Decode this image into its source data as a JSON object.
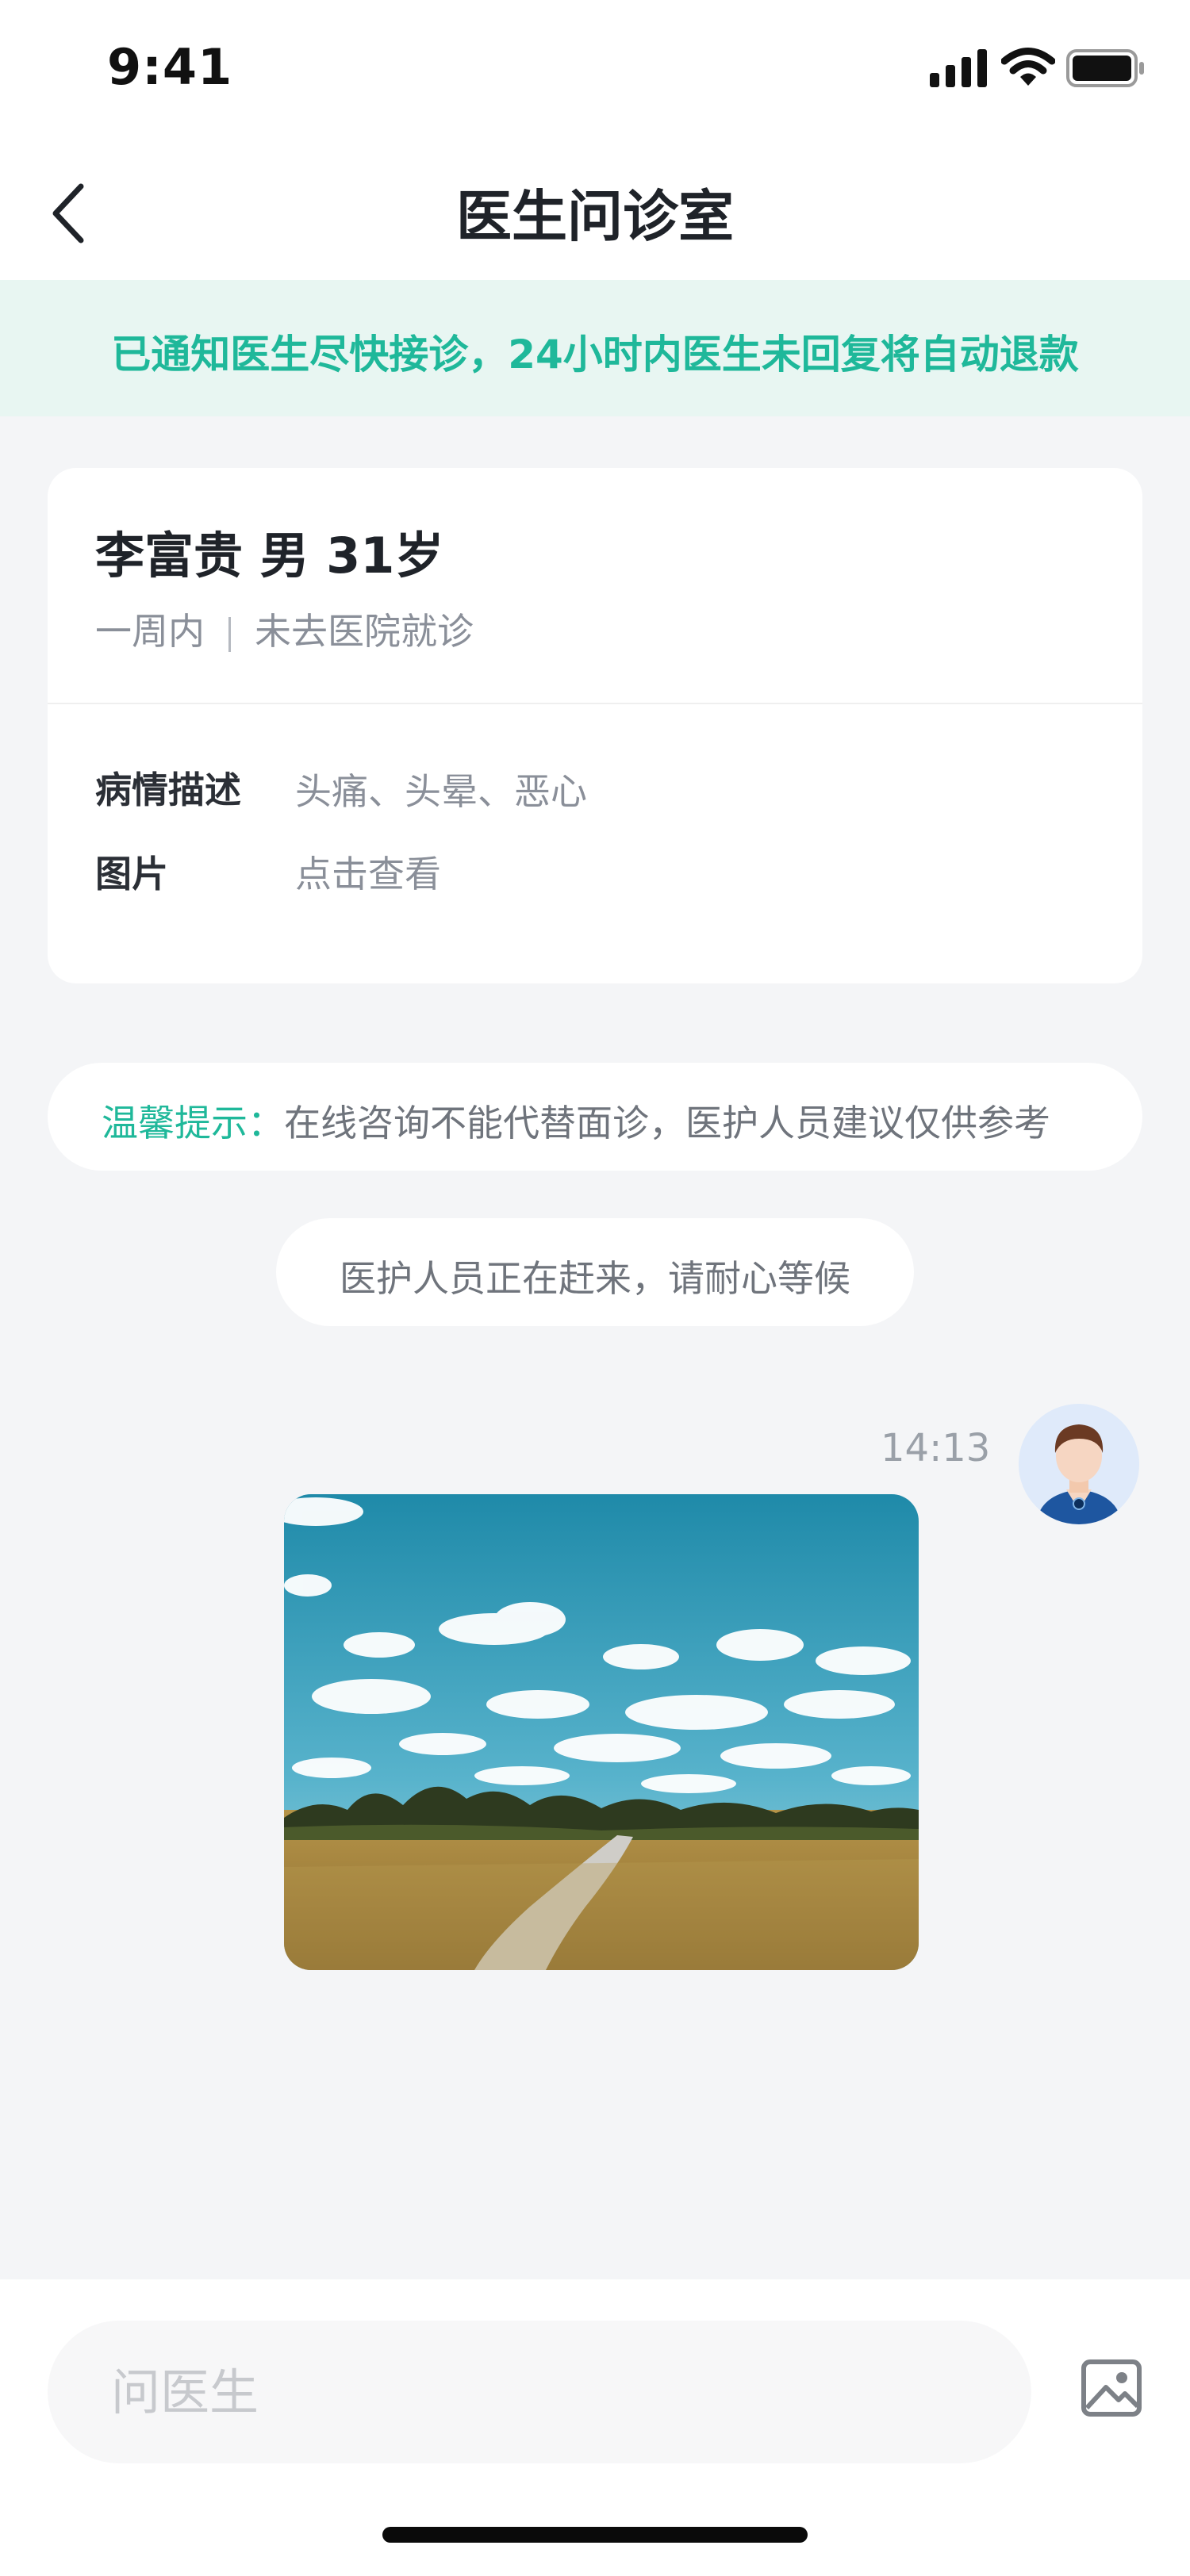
{
  "status_bar": {
    "time": "9:41",
    "icons": [
      "cellular-signal-icon",
      "wifi-icon",
      "battery-icon"
    ]
  },
  "nav": {
    "title": "医生问诊室",
    "back_icon": "chevron-left-icon"
  },
  "notice": {
    "text": "已通知医生尽快接诊，24小时内医生未回复将自动退款",
    "color": "#1fb89a"
  },
  "patient": {
    "name_line": "李富贵 男 31岁",
    "duration": "一周内",
    "visit_status": "未去医院就诊",
    "condition_label": "病情描述",
    "condition_value": "头痛、头晕、恶心",
    "images_label": "图片",
    "images_value": "点击查看"
  },
  "tip": {
    "label": "温馨提示：",
    "text": "在线咨询不能代替面诊，医护人员建议仅供参考"
  },
  "waiting": {
    "text": "医护人员正在赶来，请耐心等候"
  },
  "messages": [
    {
      "time": "14:13",
      "sender_avatar": "doctor-avatar",
      "type": "image",
      "image_subject": "landscape-photo"
    }
  ],
  "input": {
    "placeholder": "问医生",
    "value": "",
    "image_button_icon": "image-icon"
  },
  "colors": {
    "accent": "#1fb89a",
    "page_background": "#f4f5f7",
    "notice_background": "#e8f6f2"
  }
}
